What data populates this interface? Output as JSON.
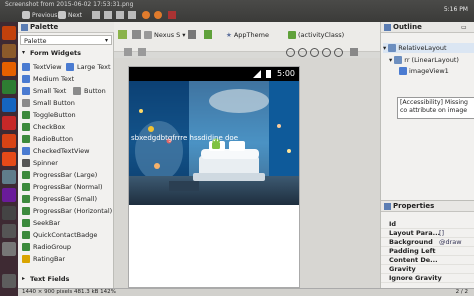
{
  "viewer": {
    "title": "Screenshot from 2015-06-02 17:53:31.png",
    "previous_label": "Previous",
    "next_label": "Next",
    "time": "5:16 PM"
  },
  "palette": {
    "tab_label": "Palette",
    "selector_value": "Palette",
    "section_form_widgets": "Form Widgets",
    "section_text_fields": "Text Fields",
    "items": [
      {
        "label": "TextView",
        "icon": "textview-icon",
        "color": "#4a7bd1"
      },
      {
        "label": "Large Text",
        "icon": "large-text-icon",
        "color": "#4a7bd1"
      },
      {
        "label": "Medium Text",
        "icon": "medium-text-icon",
        "color": "#4a7bd1"
      },
      {
        "label": "Small Text",
        "icon": "small-text-icon",
        "color": "#4a7bd1"
      },
      {
        "label": "Button",
        "icon": "button-icon",
        "color": "#8a8a8a"
      },
      {
        "label": "Small Button",
        "icon": "small-button-icon",
        "color": "#8a8a8a"
      },
      {
        "label": "ToggleButton",
        "icon": "togglebutton-icon",
        "color": "#3c8a3c"
      },
      {
        "label": "CheckBox",
        "icon": "checkbox-icon",
        "color": "#3c8a3c"
      },
      {
        "label": "RadioButton",
        "icon": "radiobutton-icon",
        "color": "#3c8a3c"
      },
      {
        "label": "CheckedTextView",
        "icon": "checkedtextview-icon",
        "color": "#4a7bd1"
      },
      {
        "label": "Spinner",
        "icon": "spinner-icon",
        "color": "#555"
      },
      {
        "label": "ProgressBar (Large)",
        "icon": "progressbar-large-icon",
        "color": "#3c8a3c"
      },
      {
        "label": "ProgressBar (Normal)",
        "icon": "progressbar-normal-icon",
        "color": "#3c8a3c"
      },
      {
        "label": "ProgressBar (Small)",
        "icon": "progressbar-small-icon",
        "color": "#3c8a3c"
      },
      {
        "label": "ProgressBar (Horizontal)",
        "icon": "progressbar-horizontal-icon",
        "color": "#3c8a3c"
      },
      {
        "label": "SeekBar",
        "icon": "seekbar-icon",
        "color": "#3c8a3c"
      },
      {
        "label": "QuickContactBadge",
        "icon": "quickcontactbadge-icon",
        "color": "#3c8a3c"
      },
      {
        "label": "RadioGroup",
        "icon": "radiogroup-icon",
        "color": "#3c8a3c"
      },
      {
        "label": "RatingBar",
        "icon": "ratingbar-icon",
        "color": "#d9a400"
      }
    ]
  },
  "editor": {
    "device_label": "Nexus S",
    "theme_label": "AppTheme",
    "activity_label": "(activityClass)"
  },
  "device": {
    "status_time": "5:00",
    "overlay_text": "sbxedgdbtgfrrre hssdidjne  doe"
  },
  "outline": {
    "tab_label": "Outline",
    "root": "RelativeLayout",
    "child": "rr (LinearLayout)",
    "leaf": "imageView1",
    "warning": "[Accessibility] Missing co attribute on image"
  },
  "properties": {
    "tab_label": "Properties",
    "rows": [
      {
        "key": "Id",
        "value": ""
      },
      {
        "key": "Layout Para...",
        "value": "[]"
      },
      {
        "key": "Background",
        "value": "@draw"
      },
      {
        "key": "Padding Left",
        "value": ""
      },
      {
        "key": "Content De...",
        "value": ""
      },
      {
        "key": "Gravity",
        "value": ""
      },
      {
        "key": "Ignore Gravity",
        "value": ""
      }
    ]
  },
  "status": {
    "left": "1440 × 900 pixels   481.3 kB   142%",
    "right": "2 / 2"
  }
}
